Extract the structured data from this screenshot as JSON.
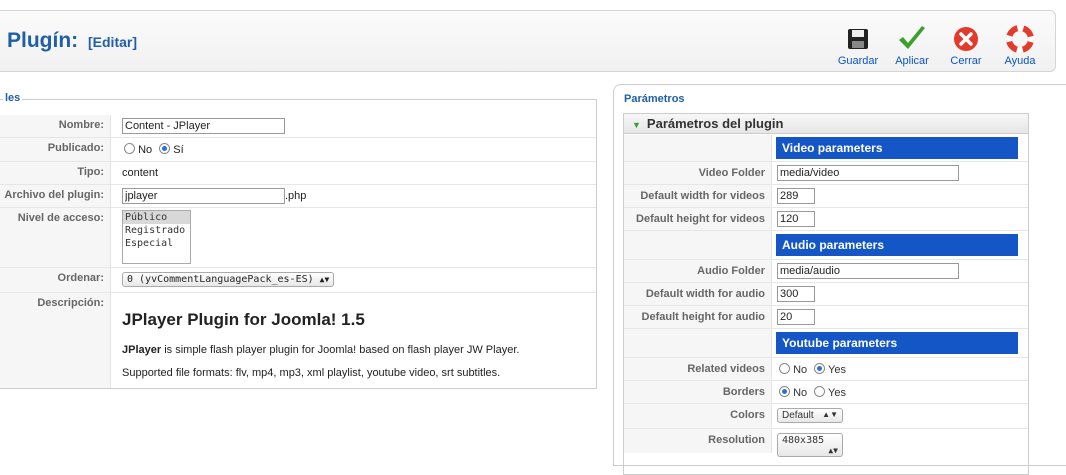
{
  "header": {
    "title": "Plugín:",
    "subtitle": "[Editar]"
  },
  "toolbar": [
    {
      "label": "Guardar",
      "icon": "save-icon"
    },
    {
      "label": "Aplicar",
      "icon": "check-icon"
    },
    {
      "label": "Cerrar",
      "icon": "close-icon"
    },
    {
      "label": "Ayuda",
      "icon": "help-icon"
    }
  ],
  "details": {
    "legend": "les",
    "name_label": "Nombre:",
    "name_value": "Content - JPlayer",
    "published_label": "Publicado:",
    "published_no": "No",
    "published_yes": "Sí",
    "published_selected": "Sí",
    "type_label": "Tipo:",
    "type_value": "content",
    "file_label": "Archivo del plugin:",
    "file_value": "jplayer",
    "file_ext": ".php",
    "access_label": "Nivel de acceso:",
    "access_options": [
      "Público",
      "Registrado",
      "Especial"
    ],
    "access_selected": "Público",
    "order_label": "Ordenar:",
    "order_value": "0 (yvCommentLanguagePack_es-ES)",
    "desc_label": "Descripción:",
    "desc_heading": "JPlayer Plugin for Joomla! 1.5",
    "desc_bold": "JPlayer",
    "desc_line1_rest": " is simple flash player plugin for Joomla! based on flash player JW Player.",
    "desc_line2": "Supported file formats: flv, mp4, mp3, xml playlist, youtube video, srt subtitles."
  },
  "params": {
    "legend": "Parámetros",
    "panel_title": "Parámetros del plugin",
    "video_section": "Video parameters",
    "video_folder_label": "Video Folder",
    "video_folder_value": "media/video",
    "video_width_label": "Default width for videos",
    "video_width_value": "289",
    "video_height_label": "Default height for videos",
    "video_height_value": "120",
    "audio_section": "Audio parameters",
    "audio_folder_label": "Audio Folder",
    "audio_folder_value": "media/audio",
    "audio_width_label": "Default width for audio",
    "audio_width_value": "300",
    "audio_height_label": "Default height for audio",
    "audio_height_value": "20",
    "youtube_section": "Youtube parameters",
    "related_label": "Related videos",
    "related_no": "No",
    "related_yes": "Yes",
    "related_selected": "Yes",
    "borders_label": "Borders",
    "borders_no": "No",
    "borders_yes": "Yes",
    "borders_selected": "No",
    "colors_label": "Colors",
    "colors_value": "Default",
    "resolution_label": "Resolution",
    "resolution_value": "480x385"
  },
  "colors": {
    "accent": "#1556c7",
    "title": "#1f5fa8"
  }
}
